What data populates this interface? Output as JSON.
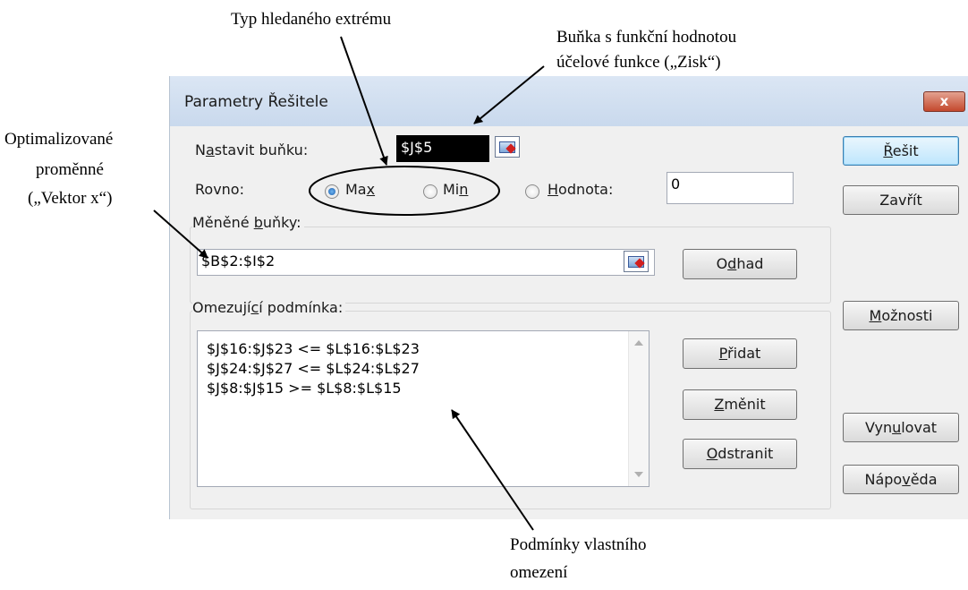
{
  "annotations": {
    "extreme_type": "Typ hledaného extrému",
    "objective_cell_line1": "Buňka s funkční hodnotou",
    "objective_cell_line2": "účelové funkce („Zisk“)",
    "variables_line1": "Optimalizované",
    "variables_line2": "proměnné",
    "variables_line3": "(„Vektor x“)",
    "constraints_line1": "Podmínky vlastního",
    "constraints_line2": "omezení"
  },
  "dialog": {
    "title": "Parametry Řešitele",
    "close_symbol": "x",
    "set_cell": {
      "label_pre": "N",
      "label_u": "a",
      "label_post": "stavit buňku:",
      "value": "$J$5"
    },
    "equal_to": {
      "label": "Rovno:",
      "max": {
        "pre": "Ma",
        "u": "x",
        "post": "",
        "checked": true
      },
      "min": {
        "pre": "Mi",
        "u": "n",
        "post": "",
        "checked": false
      },
      "value_opt": {
        "pre": "",
        "u": "H",
        "post": "odnota:",
        "checked": false
      },
      "value": "0"
    },
    "changing_cells": {
      "label_pre": "Měněné ",
      "label_u": "b",
      "label_post": "uňky:",
      "value": "$B$2:$I$2"
    },
    "constraints": {
      "label_pre": "Omezují",
      "label_u": "c",
      "label_post": "í podmínka:",
      "items": [
        "$J$16:$J$23 <= $L$16:$L$23",
        "$J$24:$J$27 <= $L$24:$L$27",
        "$J$8:$J$15 >= $L$8:$L$15"
      ]
    },
    "buttons": {
      "guess": {
        "pre": "O",
        "u": "d",
        "post": "had"
      },
      "add": {
        "pre": "",
        "u": "P",
        "post": "řidat"
      },
      "change": {
        "pre": "",
        "u": "Z",
        "post": "měnit"
      },
      "delete": {
        "pre": "",
        "u": "O",
        "post": "dstranit"
      },
      "solve": {
        "pre": "",
        "u": "Ř",
        "post": "ešit"
      },
      "close": {
        "pre": "Zavřít",
        "u": "",
        "post": ""
      },
      "options": {
        "pre": "",
        "u": "M",
        "post": "ožnosti"
      },
      "reset": {
        "pre": "Vyn",
        "u": "u",
        "post": "lovat"
      },
      "help": {
        "pre": "Nápo",
        "u": "v",
        "post": "ěda"
      }
    }
  }
}
